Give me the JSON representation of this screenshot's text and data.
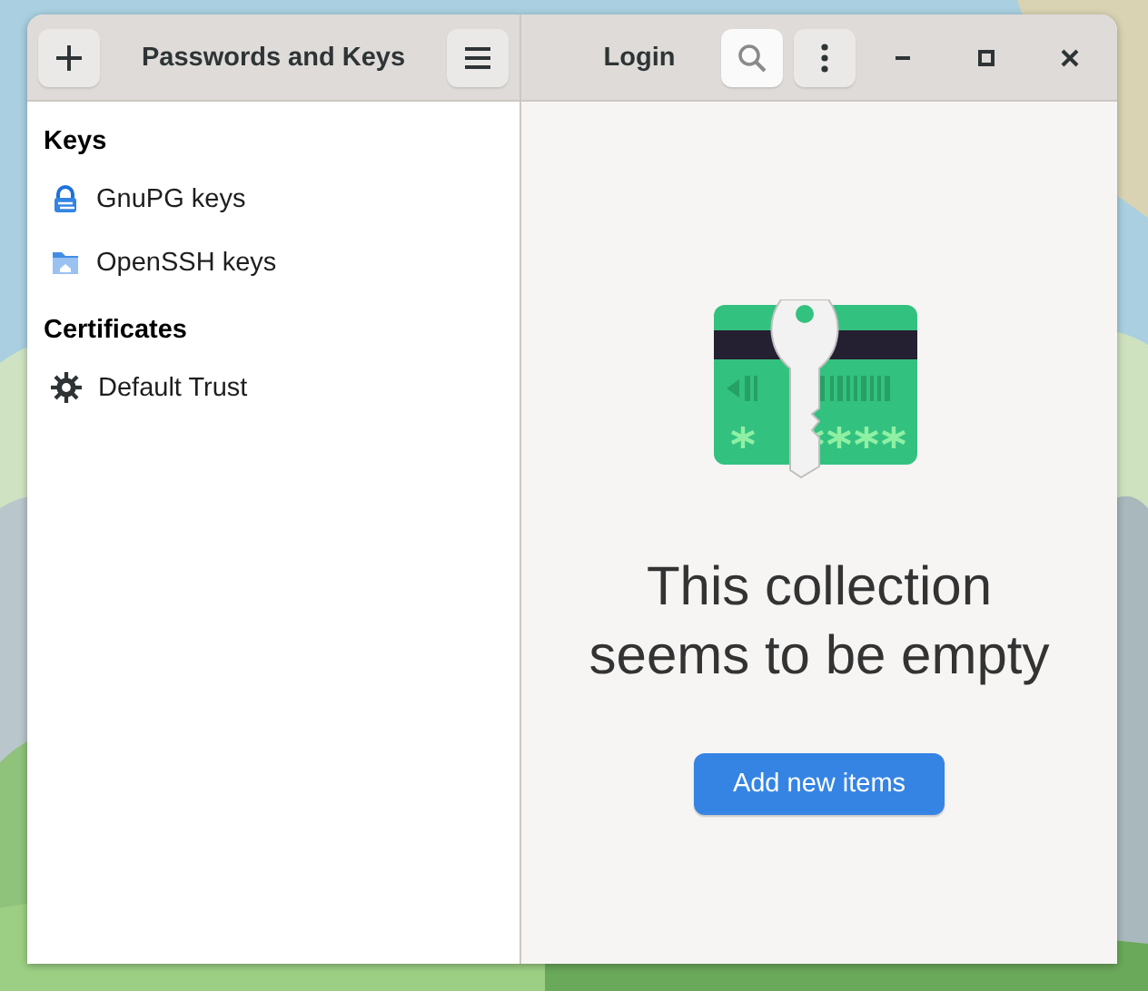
{
  "window": {
    "title": "Passwords and Keys"
  },
  "content_title": "Login",
  "search_button": {
    "active": true
  },
  "sidebar": {
    "sections": [
      {
        "heading": "Keys",
        "items": [
          {
            "label": "GnuPG keys",
            "kind": "gnupg",
            "selected": false
          },
          {
            "label": "OpenSSH keys",
            "kind": "ssh",
            "selected": false
          }
        ]
      },
      {
        "heading": "Certificates",
        "items": [
          {
            "label": "Default Trust",
            "kind": "trust",
            "selected": false
          }
        ]
      }
    ]
  },
  "empty_state": {
    "message": "This collection seems to be empty",
    "button": "Add new items"
  }
}
